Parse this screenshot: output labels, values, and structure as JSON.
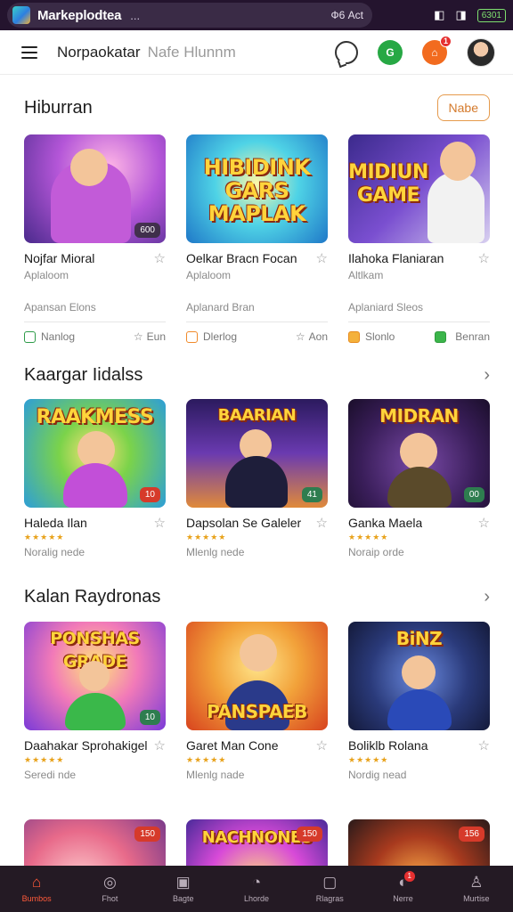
{
  "status_bar": {
    "app_title": "Markeplodtea",
    "dots": "...",
    "right_text": "Ф6 Aсt",
    "battery": "6301"
  },
  "app_bar": {
    "title": "Norpaokatar",
    "subtitle": "Nafe Hlunnm",
    "green_label": "G",
    "orange_label": "⌂",
    "notif_count": "1"
  },
  "sections": [
    {
      "title": "Hiburran",
      "action": "Nabe",
      "cards": [
        {
          "title": "Nojfar Mioral",
          "sub": "Aplaloom",
          "meta": "Apansan Elons",
          "footer_left": "Nanlog",
          "footer_right": "Eun",
          "badge": "600"
        },
        {
          "title": "Oelkar Bracn Focan",
          "sub": "Aplaloom",
          "meta": "Aplanard Bran",
          "footer_left": "Dlerlog",
          "footer_right": "Aon",
          "thumb_text": "HIBIDINK GARS MAPLAK"
        },
        {
          "title": "Ilahoka Flaniaran",
          "sub": "Altlkam",
          "meta": "Aplaniard Sleos",
          "footer_left": "Slonlo",
          "footer_right": "Benran",
          "thumb_text": "MIDIUN GAME"
        }
      ]
    },
    {
      "title": "Kaargar Iidalss",
      "cards": [
        {
          "title": "Haleda Ilan",
          "rating": "★★★★★",
          "sub": "Noralig nede",
          "badge": "10",
          "thumb_text": "RAAKMESS"
        },
        {
          "title": "Dapsolan Se Galeler",
          "rating": "★★★★★",
          "sub": "Mlenlg nede",
          "badge": "41",
          "thumb_text": "BAARIAN"
        },
        {
          "title": "Ganka Maela",
          "rating": "★★★★★",
          "sub": "Noraip orde",
          "badge": "00",
          "thumb_text": "MIDRAN"
        }
      ]
    },
    {
      "title": "Kalan Raydronas",
      "cards": [
        {
          "title": "Daahakar Sprohakigel",
          "rating": "★★★★★",
          "sub": "Seredi nde",
          "badge": "10",
          "thumb_text": "PONSHAS GRADE"
        },
        {
          "title": "Garet Man Cone",
          "rating": "★★★★★",
          "sub": "Mlenlg nade",
          "badge": "",
          "thumb_text": "PANSPAEB"
        },
        {
          "title": "Boliklb Rolana",
          "rating": "★★★★★",
          "sub": "Nordig nead",
          "badge": "",
          "thumb_text": "BiNZ"
        }
      ]
    },
    {
      "cards": [
        {
          "badge": "150"
        },
        {
          "badge": "150",
          "thumb_text": "NACHNONES"
        },
        {
          "badge": "156"
        }
      ]
    }
  ],
  "bottom_nav": [
    {
      "label": "Bumbos",
      "glyph": "⌂"
    },
    {
      "label": "Fhot",
      "glyph": "◎"
    },
    {
      "label": "Bagte",
      "glyph": "▣"
    },
    {
      "label": "Lhorde",
      "glyph": "◔"
    },
    {
      "label": "Rlagras",
      "glyph": "▢"
    },
    {
      "label": "Nerre",
      "glyph": "◐",
      "badge": "1"
    },
    {
      "label": "Murtise",
      "glyph": "♙"
    }
  ],
  "colors": {
    "accent": "#ff5a3a",
    "statusbar": "#24142e",
    "bottomnav": "#241a24"
  }
}
